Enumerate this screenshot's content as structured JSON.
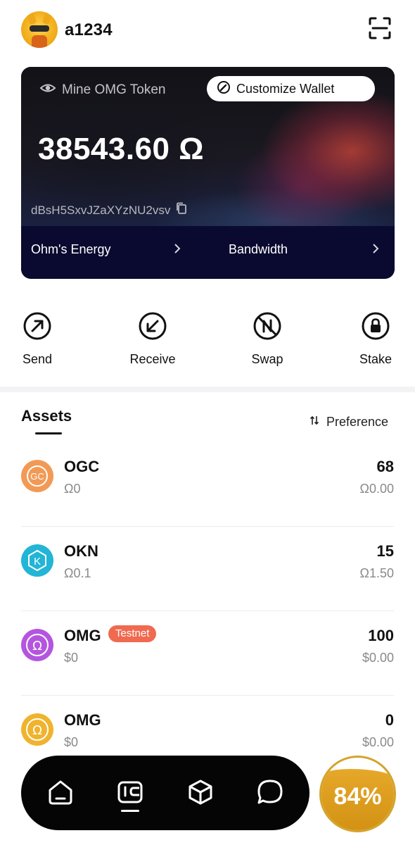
{
  "header": {
    "username": "a1234"
  },
  "wallet_card": {
    "mine_label": "Mine OMG Token",
    "customize_label": "Customize Wallet",
    "balance": "38543.60 Ω",
    "address": "dBsH5SxvJZaXYzNU2vsv",
    "link_energy": "Ohm's Energy",
    "link_bandwidth": "Bandwidth"
  },
  "actions": [
    {
      "label": "Send",
      "icon": "send-arrow-icon"
    },
    {
      "label": "Receive",
      "icon": "receive-arrow-icon"
    },
    {
      "label": "Swap",
      "icon": "swap-icon"
    },
    {
      "label": "Stake",
      "icon": "lock-icon"
    }
  ],
  "assets": {
    "title": "Assets",
    "preference_label": "Preference",
    "rows": [
      {
        "name": "OGC",
        "sub": "Ω0",
        "amount": "68",
        "value": "Ω0.00",
        "icon": "ogc-token-icon",
        "color": "#f29a55"
      },
      {
        "name": "OKN",
        "sub": "Ω0.1",
        "amount": "15",
        "value": "Ω1.50",
        "icon": "okn-token-icon",
        "color": "#22b5d6"
      },
      {
        "name": "OMG",
        "badge": "Testnet",
        "sub": "$0",
        "amount": "100",
        "value": "$0.00",
        "icon": "omg-testnet-token-icon",
        "color": "#b455e0"
      },
      {
        "name": "OMG",
        "sub": "$0",
        "amount": "0",
        "value": "$0.00",
        "icon": "omg-token-icon",
        "color": "#f0b32e"
      }
    ]
  },
  "bottom_nav": {
    "items": [
      "home-icon",
      "wallet-icon",
      "cube-icon",
      "chat-icon"
    ],
    "active": "wallet-icon"
  },
  "energy": {
    "percent_label": "84%",
    "level": 0.84
  }
}
